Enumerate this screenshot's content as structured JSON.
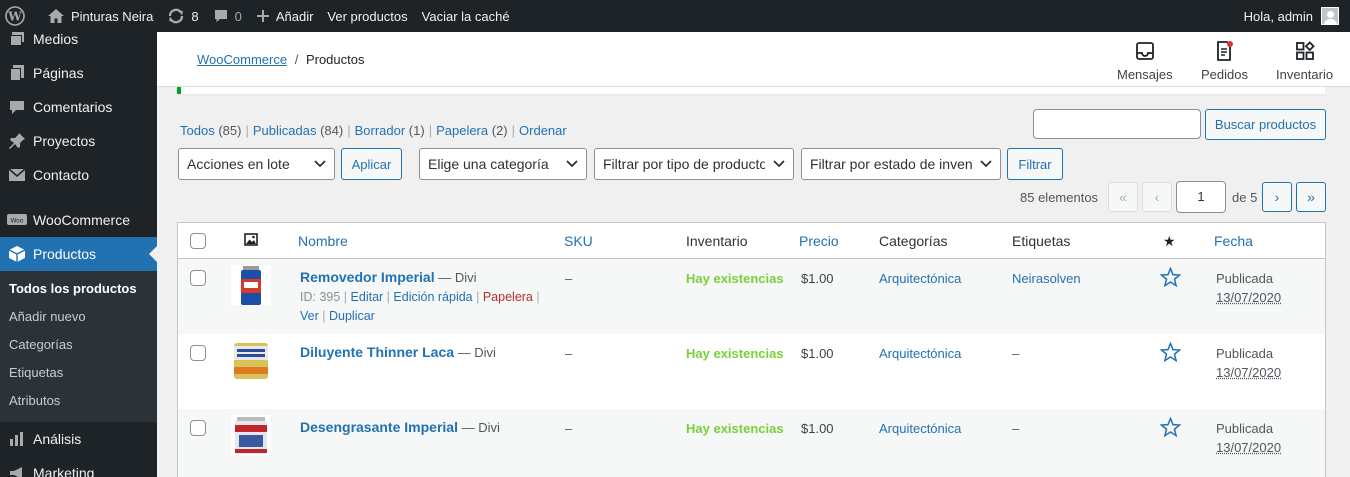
{
  "adminbar": {
    "site_name": "Pinturas Neira",
    "updates_count": "8",
    "comments_count": "0",
    "add_new": "Añadir",
    "view_products": "Ver productos",
    "clear_cache": "Vaciar la caché",
    "greeting": "Hola, admin"
  },
  "sidebar": {
    "items": [
      {
        "label": "Medios",
        "icon": "media-icon"
      },
      {
        "label": "Páginas",
        "icon": "pages-icon"
      },
      {
        "label": "Comentarios",
        "icon": "comments-icon"
      },
      {
        "label": "Proyectos",
        "icon": "pin-icon"
      },
      {
        "label": "Contacto",
        "icon": "mail-icon"
      },
      {
        "label": "WooCommerce",
        "icon": "woo-icon"
      },
      {
        "label": "Productos",
        "icon": "box-icon"
      },
      {
        "label": "Análisis",
        "icon": "chart-icon"
      },
      {
        "label": "Marketing",
        "icon": "megaphone-icon"
      }
    ],
    "submenu": [
      "Todos los productos",
      "Añadir nuevo",
      "Categorías",
      "Etiquetas",
      "Atributos"
    ]
  },
  "header": {
    "breadcrumb_link": "WooCommerce",
    "breadcrumb_sep": "/",
    "breadcrumb_current": "Productos",
    "buttons": [
      "Mensajes",
      "Pedidos",
      "Inventario"
    ]
  },
  "filters": {
    "views": [
      {
        "label": "Todos",
        "count": "(85)"
      },
      {
        "label": "Publicadas",
        "count": "(84)"
      },
      {
        "label": "Borrador",
        "count": "(1)"
      },
      {
        "label": "Papelera",
        "count": "(2)"
      },
      {
        "label": "Ordenar",
        "count": ""
      }
    ],
    "search_button": "Buscar productos",
    "bulk_actions": "Acciones en lote",
    "apply": "Aplicar",
    "category": "Elige una categoría",
    "product_type": "Filtrar por tipo de producto",
    "stock_status": "Filtrar por estado de inventario",
    "filter_button": "Filtrar"
  },
  "pagination": {
    "items": "85 elementos",
    "first": "«",
    "prev": "‹",
    "current": "1",
    "of": "de 5",
    "next": "›",
    "last": "»"
  },
  "table": {
    "columns": {
      "name": "Nombre",
      "sku": "SKU",
      "stock": "Inventario",
      "price": "Precio",
      "categories": "Categorías",
      "tags": "Etiquetas",
      "star": "★",
      "date": "Fecha"
    },
    "rows": [
      {
        "name": "Removedor Imperial",
        "suffix": "— Divi",
        "id_label": "ID: 395",
        "actions": [
          "Editar",
          "Edición rápida",
          "Papelera",
          "Ver",
          "Duplicar"
        ],
        "sku": "–",
        "stock": "Hay existencias",
        "price": "$1.00",
        "category": "Arquitectónica",
        "tags": "Neirasolven",
        "status": "Publicada",
        "date": "13/07/2020",
        "thumb_color": "#1e4fa8"
      },
      {
        "name": "Diluyente Thinner Laca",
        "suffix": "— Divi",
        "sku": "–",
        "stock": "Hay existencias",
        "price": "$1.00",
        "category": "Arquitectónica",
        "tags": "–",
        "status": "Publicada",
        "date": "13/07/2020",
        "thumb_color": "#c9b24a"
      },
      {
        "name": "Desengrasante Imperial",
        "suffix": "— Divi",
        "sku": "–",
        "stock": "Hay existencias",
        "price": "$1.00",
        "category": "Arquitectónica",
        "tags": "–",
        "status": "Publicada",
        "date": "13/07/2020",
        "thumb_color": "#3a5aa0"
      }
    ]
  }
}
